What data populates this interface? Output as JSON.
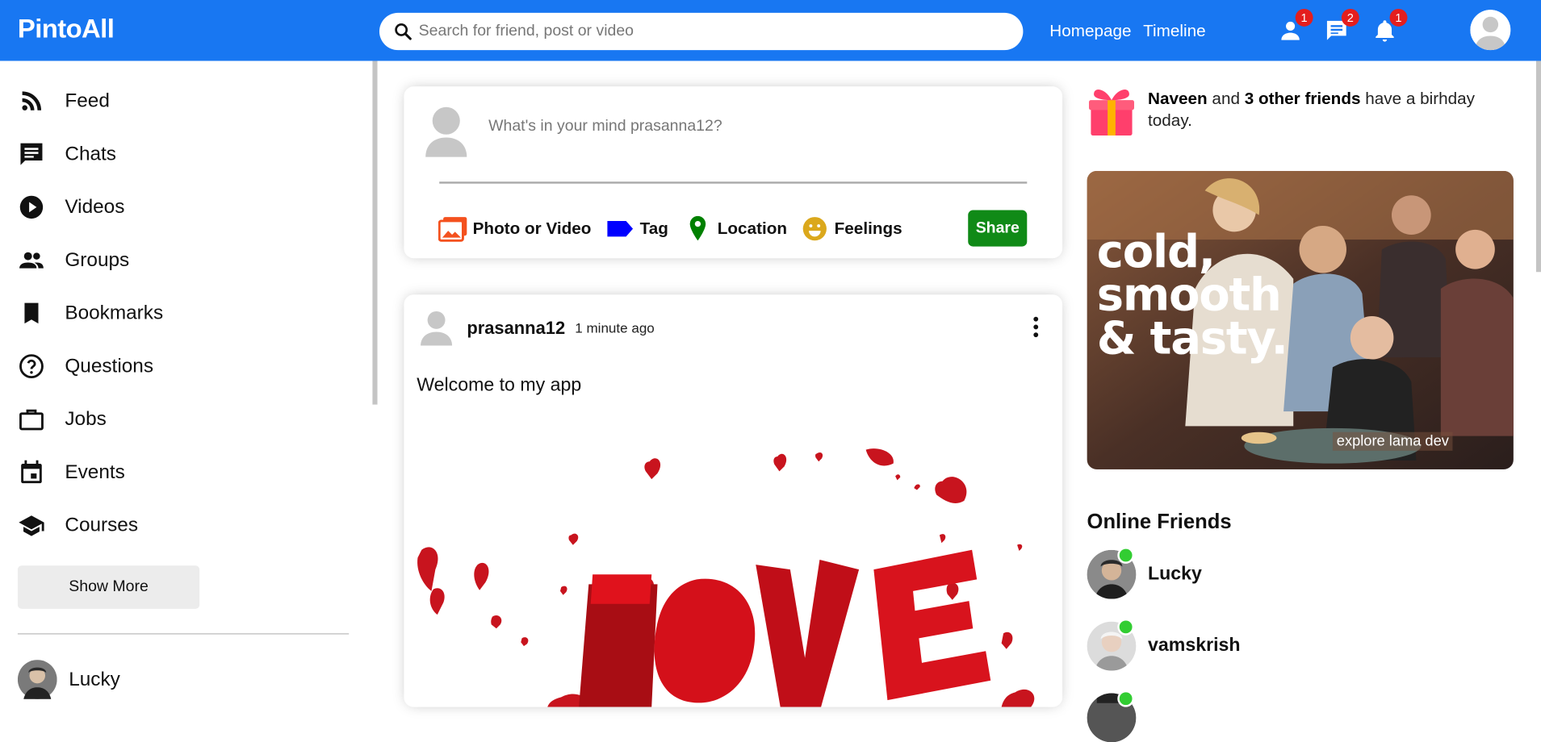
{
  "app": {
    "logo": "PintoAll"
  },
  "topbar": {
    "search_placeholder": "Search for friend, post or video",
    "links": [
      "Homepage",
      "Timeline"
    ],
    "badges": {
      "friends": "1",
      "chats": "2",
      "notifications": "1"
    },
    "brand_color": "#1877f2"
  },
  "sidebar": {
    "items": [
      {
        "label": "Feed",
        "icon": "rss-feed-icon"
      },
      {
        "label": "Chats",
        "icon": "chat-icon"
      },
      {
        "label": "Videos",
        "icon": "play-circle-icon"
      },
      {
        "label": "Groups",
        "icon": "group-icon"
      },
      {
        "label": "Bookmarks",
        "icon": "bookmark-icon"
      },
      {
        "label": "Questions",
        "icon": "help-circle-icon"
      },
      {
        "label": "Jobs",
        "icon": "briefcase-icon"
      },
      {
        "label": "Events",
        "icon": "calendar-event-icon"
      },
      {
        "label": "Courses",
        "icon": "graduation-cap-icon"
      }
    ],
    "show_more": "Show More",
    "friends": [
      {
        "name": "Lucky"
      }
    ]
  },
  "share": {
    "placeholder": "What's in your mind prasanna12?",
    "options": [
      {
        "label": "Photo or Video",
        "icon": "photo-library-icon",
        "color": "#f4511e"
      },
      {
        "label": "Tag",
        "icon": "label-icon",
        "color": "#0000ff"
      },
      {
        "label": "Location",
        "icon": "location-pin-icon",
        "color": "#008000"
      },
      {
        "label": "Feelings",
        "icon": "emoji-icon",
        "color": "#dba81c"
      }
    ],
    "button": "Share",
    "button_color": "#108a17"
  },
  "post": {
    "username": "prasanna12",
    "date": "1 minute ago",
    "text": "Welcome to my app",
    "image_word": "LOVE"
  },
  "rightbar": {
    "birthday": {
      "name": "Naveen",
      "mid": " and ",
      "others": "3 other friends",
      "rest": " have a birhday today."
    },
    "ad": {
      "headline": [
        "cold,",
        "smooth",
        "& tasty."
      ],
      "footer": "explore lama dev"
    },
    "online_title": "Online Friends",
    "online_friends": [
      {
        "name": "Lucky"
      },
      {
        "name": "vamskrish"
      },
      {
        "name": ""
      }
    ],
    "online_color": "#32cd32"
  }
}
